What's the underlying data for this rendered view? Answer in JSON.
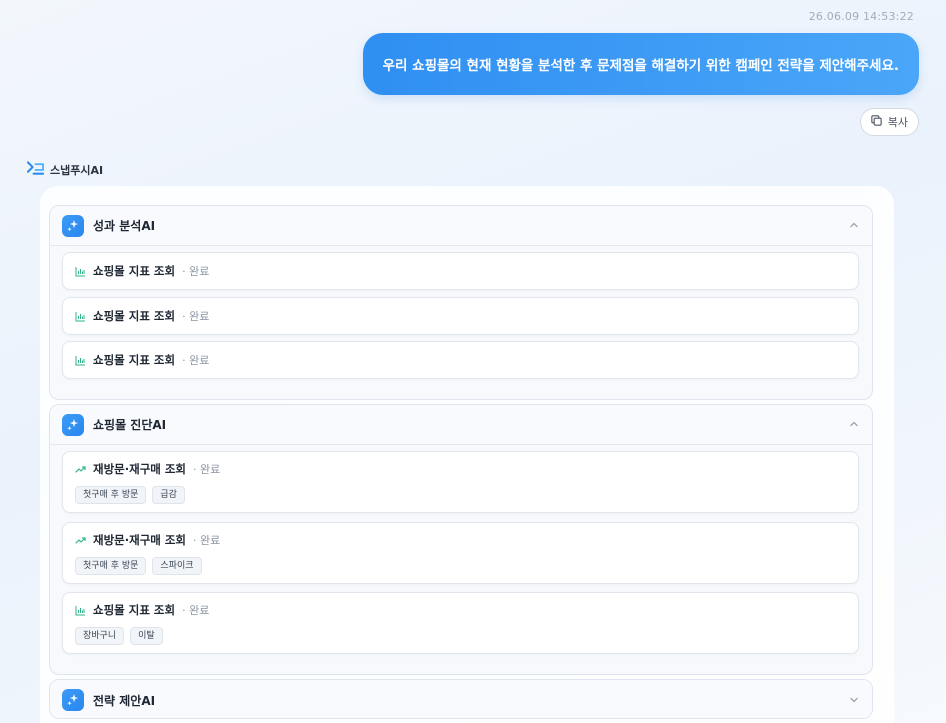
{
  "timestamp": "26.06.09 14:53:22",
  "user_message": "우리 쇼핑몰의 현재 현황을 분석한 후 문제점을 해결하기 위한 캠페인 전략을 제안해주세요.",
  "copy_label": "복사",
  "assistant_name": "스냅푸시AI",
  "agents": [
    {
      "title": "성과 분석AI",
      "expanded": true,
      "items": [
        {
          "icon": "bar-chart-icon",
          "name": "쇼핑몰 지표 조회",
          "status": "· 완료",
          "tags": []
        },
        {
          "icon": "bar-chart-icon",
          "name": "쇼핑몰 지표 조회",
          "status": "· 완료",
          "tags": []
        },
        {
          "icon": "bar-chart-icon",
          "name": "쇼핑몰 지표 조회",
          "status": "· 완료",
          "tags": []
        }
      ]
    },
    {
      "title": "쇼핑몰 진단AI",
      "expanded": true,
      "items": [
        {
          "icon": "trend-up-icon",
          "name": "재방문·재구매 조회",
          "status": "· 완료",
          "tags": [
            "첫구매 후 방문",
            "급감"
          ]
        },
        {
          "icon": "trend-up-icon",
          "name": "재방문·재구매 조회",
          "status": "· 완료",
          "tags": [
            "첫구매 후 방문",
            "스파이크"
          ]
        },
        {
          "icon": "bar-chart-icon",
          "name": "쇼핑몰 지표 조회",
          "status": "· 완료",
          "tags": [
            "장바구니",
            "이탈"
          ]
        }
      ]
    },
    {
      "title": "전략 제안AI",
      "expanded": false,
      "items": []
    }
  ],
  "colors": {
    "accent": "#3a9af5",
    "icon_green": "#2fb48a"
  }
}
